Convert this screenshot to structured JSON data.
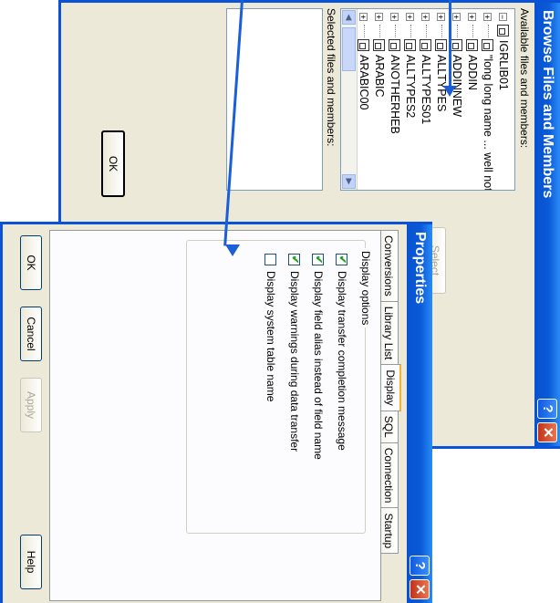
{
  "browse": {
    "title": "Browse Files and Members",
    "available_label": "Available files and members:",
    "selected_label": "Selected files and members:",
    "tree": [
      {
        "prefix": "minus",
        "name": "IGRLIB01"
      },
      {
        "prefix": "plus",
        "name": "\"long long name ... well not so long\""
      },
      {
        "prefix": "plus",
        "name": "ADDIN"
      },
      {
        "prefix": "plus",
        "name": "ADDINNEW"
      },
      {
        "prefix": "plus",
        "name": "ALLTYPES"
      },
      {
        "prefix": "plus",
        "name": "ALLTYPES01"
      },
      {
        "prefix": "plus",
        "name": "ALLTYPES2"
      },
      {
        "prefix": "plus",
        "name": "ANOTHERHEB"
      },
      {
        "prefix": "plus",
        "name": "ARABIC"
      },
      {
        "prefix": "plus",
        "name": "ARABIC00"
      }
    ],
    "select_button": "Select",
    "ok_button": "OK"
  },
  "props": {
    "title": "Properties",
    "tabs": [
      "Conversions",
      "Library List",
      "Display",
      "SQL",
      "Connection",
      "Startup"
    ],
    "active_tab": "Display",
    "group_title": "Display options",
    "options": [
      {
        "label": "Display transfer completion message",
        "checked": true
      },
      {
        "label": "Display field alias instead of field name",
        "checked": true
      },
      {
        "label": "Display warnings during data transfer",
        "checked": true
      },
      {
        "label": "Display system table name",
        "checked": false
      }
    ],
    "buttons": {
      "ok": "OK",
      "cancel": "Cancel",
      "apply": "Apply",
      "help": "Help"
    }
  },
  "icons": {
    "help": "?",
    "close": "✕",
    "scroll_left": "◀",
    "scroll_right": "▶"
  },
  "colors": {
    "titlebar": "#0a5ad8",
    "dialog_bg": "#ece9d8",
    "arrow": "#1a5fd8"
  }
}
